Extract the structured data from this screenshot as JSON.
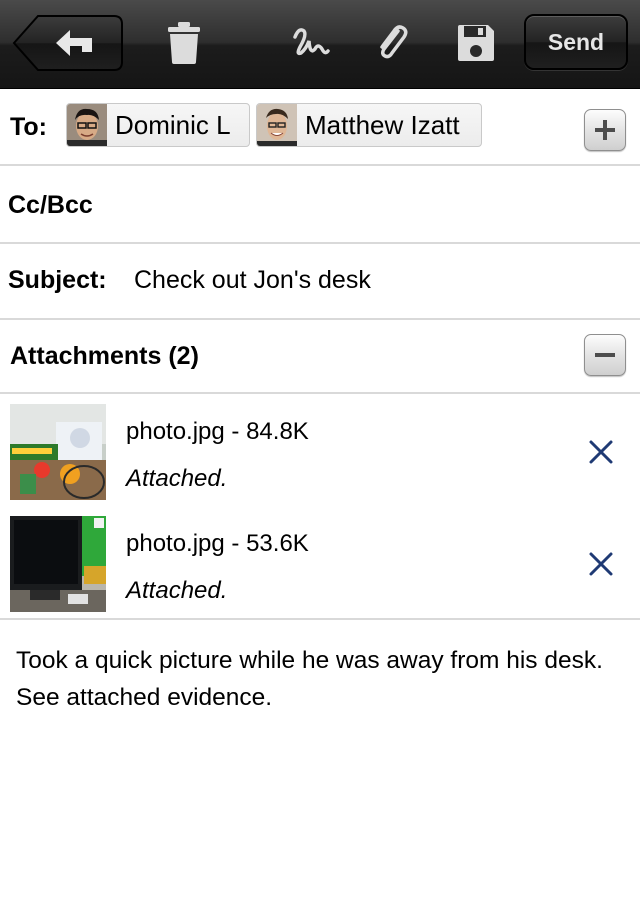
{
  "toolbar": {
    "back_icon": "reply-arrow-icon",
    "delete_icon": "trash-icon",
    "signature_icon": "signature-squiggle-icon",
    "attach_icon": "paperclip-icon",
    "save_icon": "floppy-disk-icon",
    "send_label": "Send"
  },
  "to": {
    "label": "To:",
    "recipients": [
      {
        "name": "Dominic L",
        "avatar": "avatar-photo"
      },
      {
        "name": "Matthew Izatt",
        "avatar": "avatar-photo"
      }
    ],
    "add_icon": "plus-icon"
  },
  "cc": {
    "label": "Cc/Bcc"
  },
  "subject": {
    "label": "Subject:",
    "value": "Check out Jon's desk"
  },
  "attachments": {
    "header": "Attachments (2)",
    "collapse_icon": "minus-icon",
    "items": [
      {
        "name": "photo.jpg - 84.8K",
        "status": "Attached.",
        "remove_icon": "close-x-icon"
      },
      {
        "name": "photo.jpg - 53.6K",
        "status": "Attached.",
        "remove_icon": "close-x-icon"
      }
    ]
  },
  "body": {
    "text": "Took a quick picture while he was away from his desk. See attached evidence."
  },
  "colors": {
    "toolbar_top": "#4a4a4a",
    "toolbar_bottom": "#151515",
    "remove_x": "#1f3a74",
    "divider": "#d9d9d9"
  }
}
